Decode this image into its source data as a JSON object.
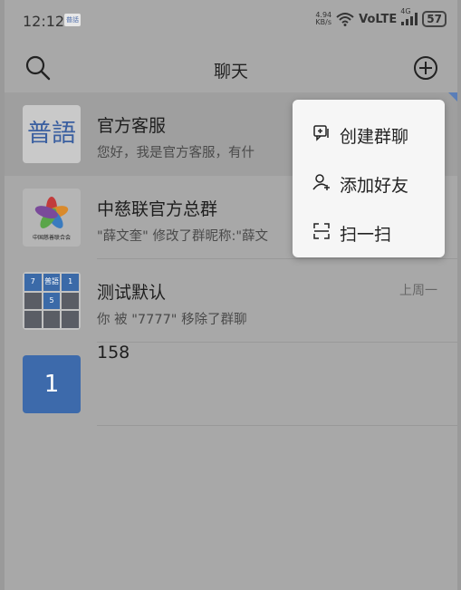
{
  "status_bar": {
    "time": "12:12",
    "app_badge": "普話",
    "net_speed_value": "4.94",
    "net_speed_unit": "KB/s",
    "volte": "VoLTE",
    "network": "4G",
    "battery": "57"
  },
  "nav": {
    "title": "聊天"
  },
  "chats": [
    {
      "name": "官方客服",
      "preview": "您好，我是官方客服，有什",
      "time": "",
      "avatar_text": "普語"
    },
    {
      "name": "中慈联官方总群",
      "preview": "\"薛文奎\" 修改了群昵称:\"薛文",
      "time": "",
      "avatar_text": "中国慈善联合会"
    },
    {
      "name": "测试默认",
      "preview": "你 被 \"7777\" 移除了群聊",
      "time": "上周一",
      "avatar_text": [
        "7",
        "普語",
        "1",
        "",
        "5",
        "",
        "",
        "",
        ""
      ]
    },
    {
      "name": "158",
      "preview": "",
      "time": "",
      "avatar_text": "1"
    }
  ],
  "popup_menu": [
    {
      "label": "创建群聊",
      "icon": "create-group-icon"
    },
    {
      "label": "添加好友",
      "icon": "add-friend-icon"
    },
    {
      "label": "扫一扫",
      "icon": "scan-icon"
    }
  ],
  "colors": {
    "accent_blue": "#3d6aab",
    "popup_bg": "#f6f6f6",
    "overlay_bg": "#a8a8a8"
  }
}
